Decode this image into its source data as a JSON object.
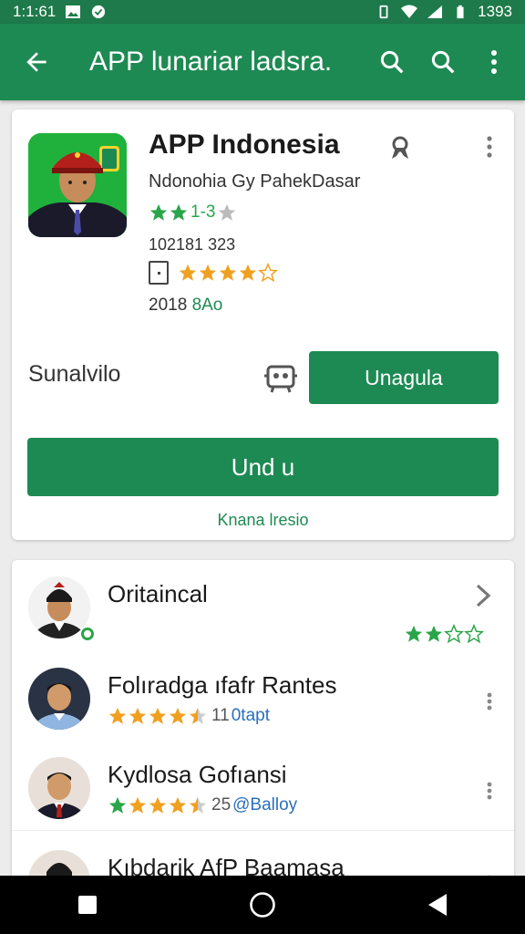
{
  "status": {
    "time": "1:1:61",
    "right_time": "1393"
  },
  "appbar": {
    "title": "APP lunariar ladsra.",
    "back_icon": "arrow-back-icon",
    "search_icon": "search-icon",
    "search2_icon": "search-icon",
    "more_icon": "more-vert-icon"
  },
  "app": {
    "name": "APP Indonesia",
    "developer": "Ndonohia Gy PahekDasar",
    "rating_text": "1-3",
    "downloads": "102181 323",
    "updated_prefix": "2018",
    "updated_suffix": "8Ao",
    "subscribe_label": "Sunalvilo",
    "upgrade_label": "Unagula",
    "install_label": "Und  u",
    "link_label": "Knana lresio"
  },
  "list": [
    {
      "name": "Oritaincal",
      "meta_count": "",
      "meta_tag": "",
      "trailing": "chevron-right-icon"
    },
    {
      "name": "Folıradga ıfafr Rantes",
      "meta_count": "11",
      "meta_tag": "0tapt",
      "trailing": "more-vert-icon"
    },
    {
      "name": "Kydlosa Gofıansi",
      "meta_count": "25",
      "meta_tag": "@Balloy",
      "trailing": "more-vert-icon"
    },
    {
      "name": "Kıbdarik AfP Baamasa",
      "meta_count": "",
      "meta_tag": "",
      "trailing": "more-vert-icon"
    }
  ],
  "colors": {
    "primary": "#1e8a53",
    "star_gold": "#f0a020",
    "star_green": "#2aa54a"
  }
}
